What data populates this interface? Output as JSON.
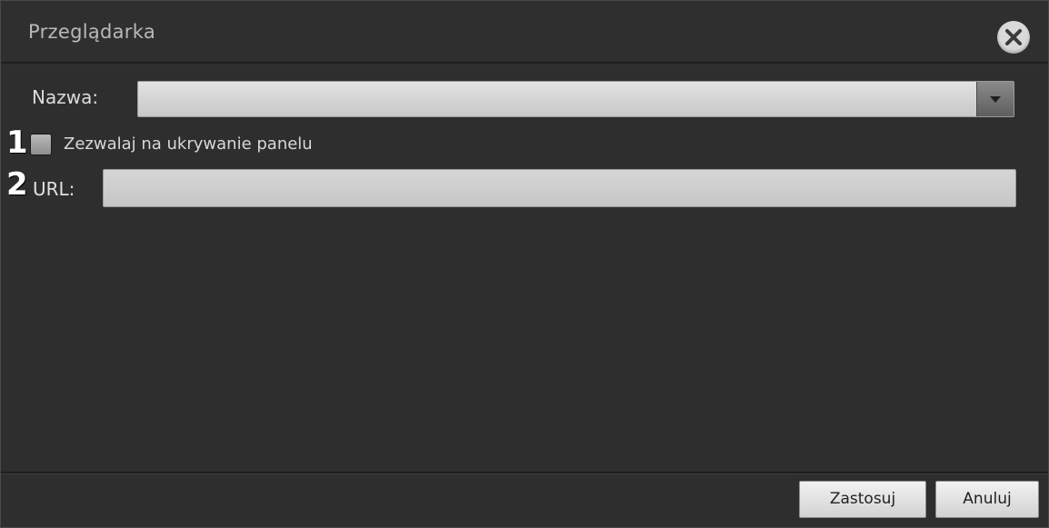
{
  "dialog": {
    "title": "Przeglądarka",
    "close_icon": "close-circle-icon"
  },
  "form": {
    "name": {
      "label": "Nazwa:",
      "value": "",
      "dropdown_icon": "chevron-down-icon"
    },
    "badges": {
      "first": "1",
      "second": "2"
    },
    "allow_hide_panel": {
      "label": "Zezwalaj na ukrywanie panelu",
      "checked": false
    },
    "url": {
      "label": "URL:",
      "value": ""
    }
  },
  "footer": {
    "apply_label": "Zastosuj",
    "cancel_label": "Anuluj"
  },
  "colors": {
    "background": "#2e2e2e",
    "title_text": "#b9b9b9",
    "label_text": "#dcdcdc",
    "input_bg": "#d0d0d0"
  }
}
